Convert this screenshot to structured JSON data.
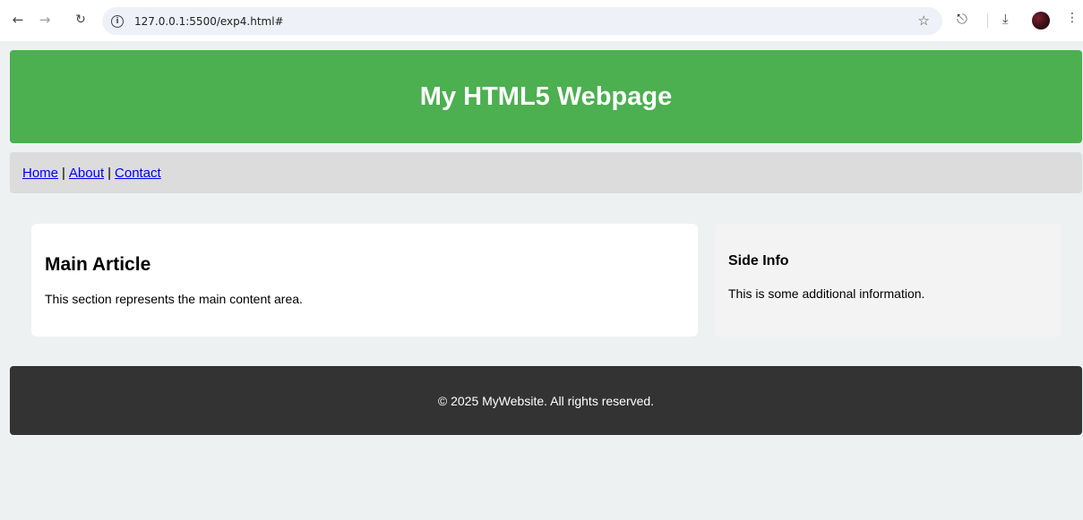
{
  "browser": {
    "url": "127.0.0.1:5500/exp4.html#",
    "icons": {
      "back": "arrow-left-icon",
      "forward": "arrow-right-icon",
      "reload": "reload-icon",
      "info": "info-icon",
      "bookmark": "star-icon",
      "extensions": "puzzle-icon",
      "download": "download-icon",
      "menu": "kebab-menu-icon"
    }
  },
  "header": {
    "title": "My HTML5 Webpage",
    "bg_color": "#4caf50"
  },
  "nav": {
    "links": [
      {
        "label": "Home"
      },
      {
        "label": "About"
      },
      {
        "label": "Contact"
      }
    ],
    "separator": "|"
  },
  "main": {
    "heading": "Main Article",
    "body": "This section represents the main content area."
  },
  "aside": {
    "heading": "Side Info",
    "body": "This is some additional information."
  },
  "footer": {
    "text": "© 2025 MyWebsite. All rights reserved.",
    "bg_color": "#333333"
  }
}
